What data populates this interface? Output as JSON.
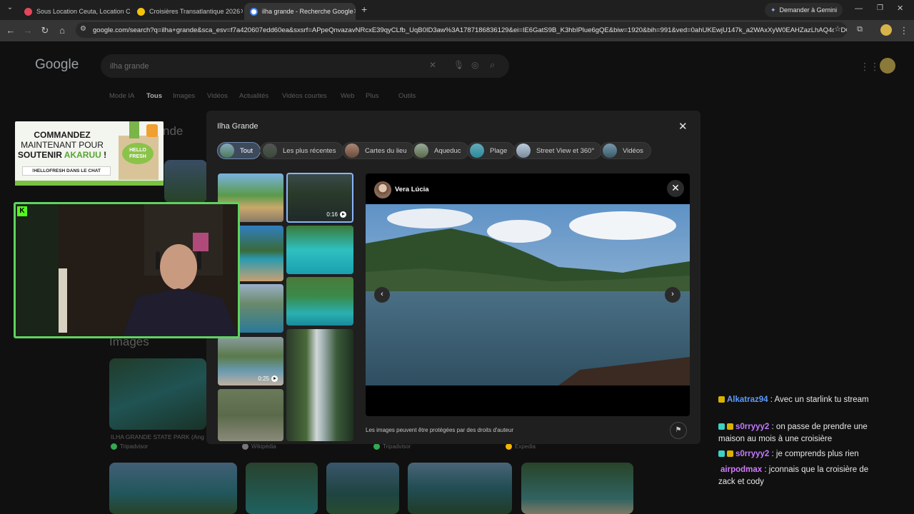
{
  "browser": {
    "tabs": [
      {
        "title": "Sous Location Ceuta, Location C",
        "favicon_color": "#e2475b"
      },
      {
        "title": "Croisières Transatlantique 2026",
        "favicon_color": "#f4c20d"
      },
      {
        "title": "ilha grande - Recherche Google",
        "favicon_color": "#ffffff"
      }
    ],
    "new_tab": "+",
    "gemini_button": "Demander à Gemini",
    "url": "google.com/search?q=ilha+grande&sca_esv=f7a420607edd60ea&sxsrf=APpeQnvazavNRcxE39qyCLfb_UqB0ID3aw%3A1787186836129&ei=IE6GatS9B_K3hbIPlue6gQE&biw=1920&bih=991&ved=0ahUKEwjU147k_a2WAxXyW0EAHZazLhAQ4dUDCB..."
  },
  "google": {
    "logo": "Google",
    "query": "ilha grande",
    "nav_tabs": [
      "Mode IA",
      "Tous",
      "Images",
      "Vidéos",
      "Actualités",
      "Vidéos courtes",
      "Web",
      "Plus",
      "Outils"
    ],
    "active_tab": "Tous",
    "bg_title": "nde",
    "images_heading": "Images",
    "results": [
      {
        "title": "ILHA GRANDE STATE PARK (Ang",
        "source": "Tripadvisor"
      },
      {
        "title": "",
        "source": "Wikipédia"
      },
      {
        "title": "",
        "source": "Tripadvisor"
      },
      {
        "title": "",
        "source": "Expedia"
      }
    ]
  },
  "panel": {
    "title": "Ilha Grande",
    "chips": [
      "Tout",
      "Les plus récentes",
      "Cartes du lieu",
      "Aqueduc",
      "Plage",
      "Street View et 360°",
      "Vidéos"
    ],
    "selected_chip": "Tout",
    "thumbs": {
      "video1_duration": "0:16",
      "video2_duration": "0:25"
    },
    "viewer": {
      "author": "Vera Lúcia",
      "copyright": "Les images peuvent être protégées par des droits d'auteur"
    }
  },
  "overlay": {
    "promo": {
      "line1": "COMMANDEZ",
      "line2": "MAINTENANT POUR",
      "line3a": "SOUTENIR ",
      "line3b": "AKARUU",
      "line3c": " !",
      "tag": "!HELLOFRESH DANS LE CHAT",
      "brand": "HELLO FRESH"
    },
    "cam_logo": "K"
  },
  "chat": [
    {
      "user": "Alkatraz94",
      "color": "#5b9bff",
      "badge": "#d9b100",
      "message": "Avec un starlink tu stream"
    },
    {
      "user": "s0rryyy2",
      "color": "#c27bff",
      "badge": "#3bd1c6",
      "message": "on passe de prendre une maison au mois à une croisière"
    },
    {
      "user": "s0rryyy2",
      "color": "#c27bff",
      "badge": "#3bd1c6",
      "message": "je comprends plus rien"
    },
    {
      "user": "airpodmax",
      "color": "#d07bff",
      "badge": "",
      "message": "jconnais que la croisière de zack et cody"
    }
  ]
}
